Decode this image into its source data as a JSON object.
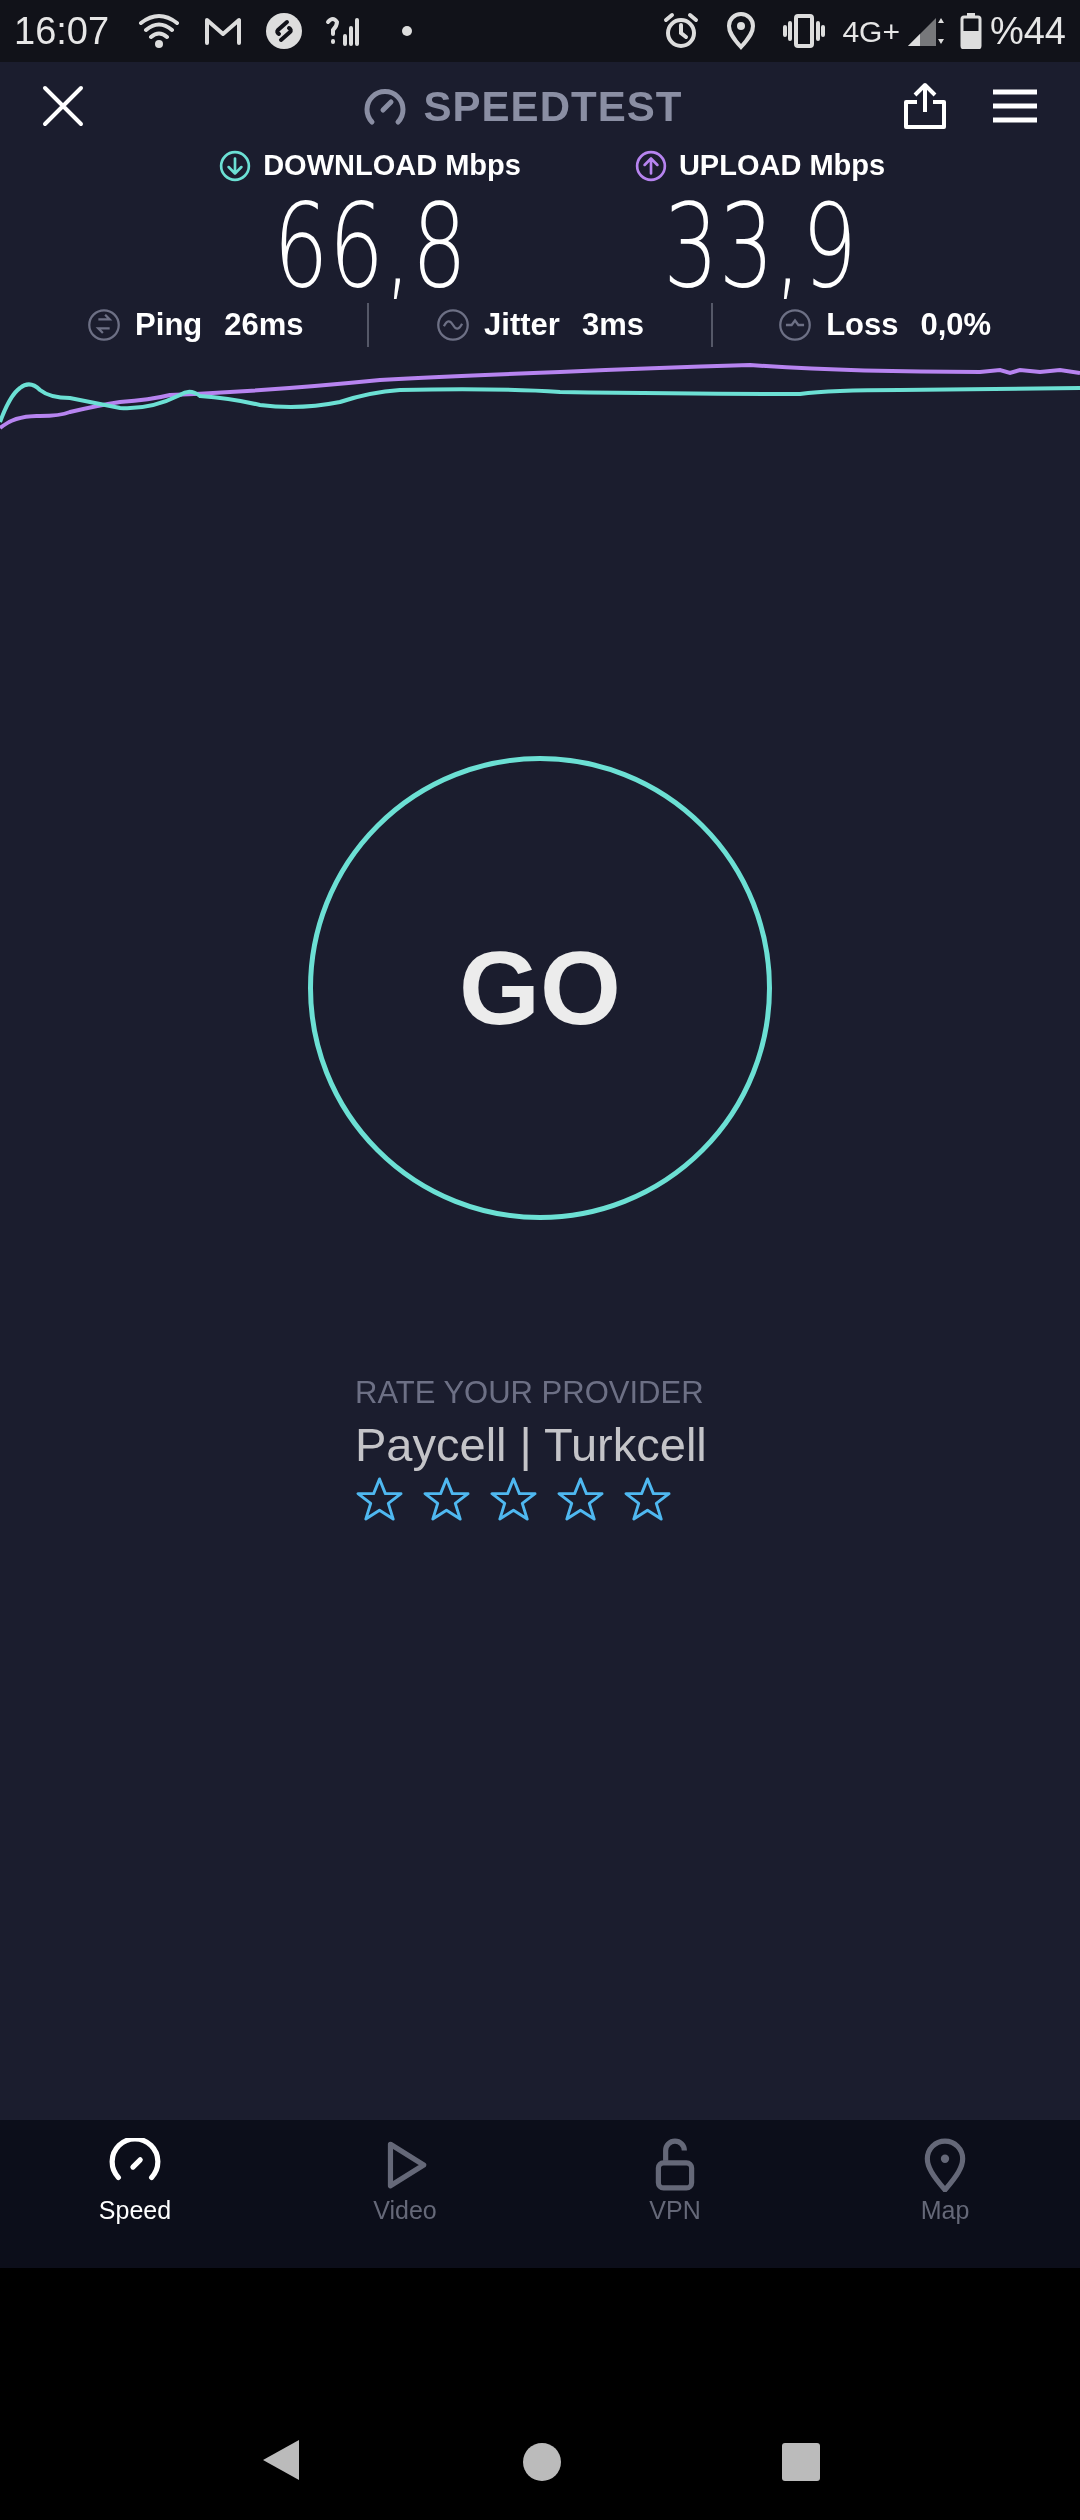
{
  "status_bar": {
    "time": "16:07",
    "network": "4G+",
    "battery": "%44"
  },
  "header": {
    "title": "SPEEDTEST"
  },
  "results": [
    {
      "kind": "download",
      "label": "DOWNLOAD Mbps",
      "value": "66,8"
    },
    {
      "kind": "upload",
      "label": "UPLOAD Mbps",
      "value": "33,9"
    }
  ],
  "stats": [
    {
      "kind": "ping",
      "label": "Ping",
      "value": "26ms"
    },
    {
      "kind": "jitter",
      "label": "Jitter",
      "value": "3ms"
    },
    {
      "kind": "loss",
      "label": "Loss",
      "value": "0,0%"
    }
  ],
  "go_button": {
    "label": "GO"
  },
  "rating": {
    "prompt": "RATE YOUR PROVIDER",
    "provider": "Paycell | Turkcell",
    "stars": 0
  },
  "tabs": [
    {
      "kind": "speed",
      "label": "Speed",
      "selected": true
    },
    {
      "kind": "video",
      "label": "Video",
      "selected": false
    },
    {
      "kind": "vpn",
      "label": "VPN",
      "selected": false
    },
    {
      "kind": "map",
      "label": "Map",
      "selected": false
    }
  ]
}
